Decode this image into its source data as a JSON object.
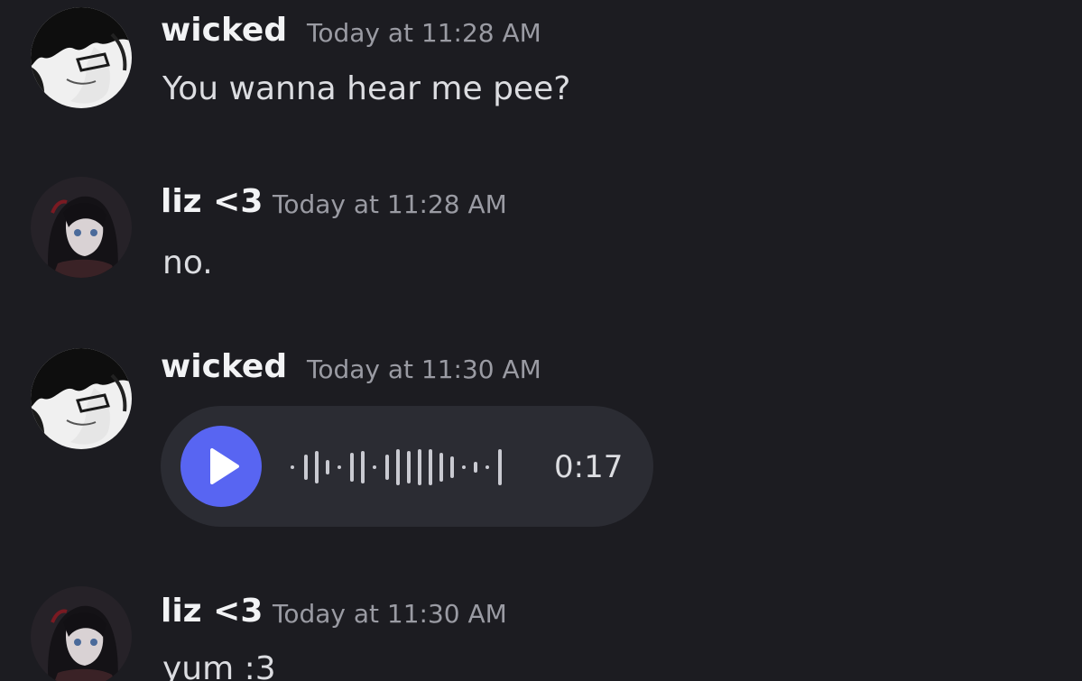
{
  "messages": [
    {
      "author": "wicked",
      "timestamp": "Today at 11:28 AM",
      "text": "You wanna hear me pee?",
      "avatar_icon": "wicked-avatar"
    },
    {
      "author": "liz <3",
      "timestamp": "Today at 11:28 AM",
      "text": "no.",
      "avatar_icon": "liz-avatar"
    },
    {
      "author": "wicked",
      "timestamp": "Today at 11:30 AM",
      "voice_message": {
        "duration": "0:17",
        "play_icon": "play-icon",
        "accent_color": "#5865f2"
      },
      "avatar_icon": "wicked-avatar"
    },
    {
      "author": "liz <3",
      "timestamp": "Today at 11:30 AM",
      "text": "yum :3",
      "avatar_icon": "liz-avatar"
    }
  ],
  "colors": {
    "background": "#1c1c21",
    "username": "#f2f3f5",
    "timestamp": "#9a9ba3",
    "message_text": "#dcdde1",
    "voice_bubble": "#2b2c33"
  }
}
